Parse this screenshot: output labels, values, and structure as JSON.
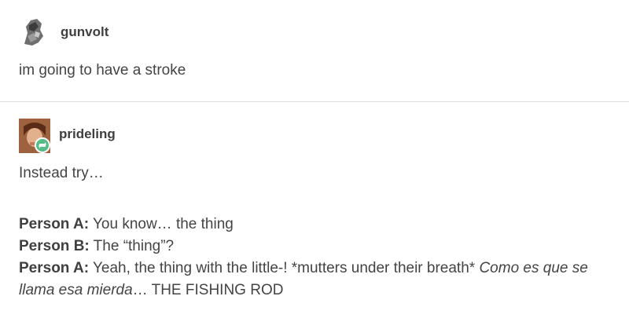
{
  "post1": {
    "username": "gunvolt",
    "body": "im going to have a stroke"
  },
  "post2": {
    "username": "prideling",
    "intro": "Instead try…",
    "lines": [
      {
        "speaker": "Person A:",
        "text": " You know… the thing"
      },
      {
        "speaker": "Person B:",
        "text": " The “thing”?"
      },
      {
        "speaker": "Person A:",
        "text": " Yeah, the thing with the little-! *mutters under their breath* "
      }
    ],
    "italic_phrase": "Como es que se llama esa mierda",
    "ending": "… THE FISHING ROD"
  },
  "icons": {
    "avatar1": "user-avatar-icon",
    "avatar2": "user-avatar-icon",
    "reblog": "reblog-icon"
  },
  "colors": {
    "reblog_badge": "#56bc8a",
    "divider": "#dcdcdc"
  }
}
